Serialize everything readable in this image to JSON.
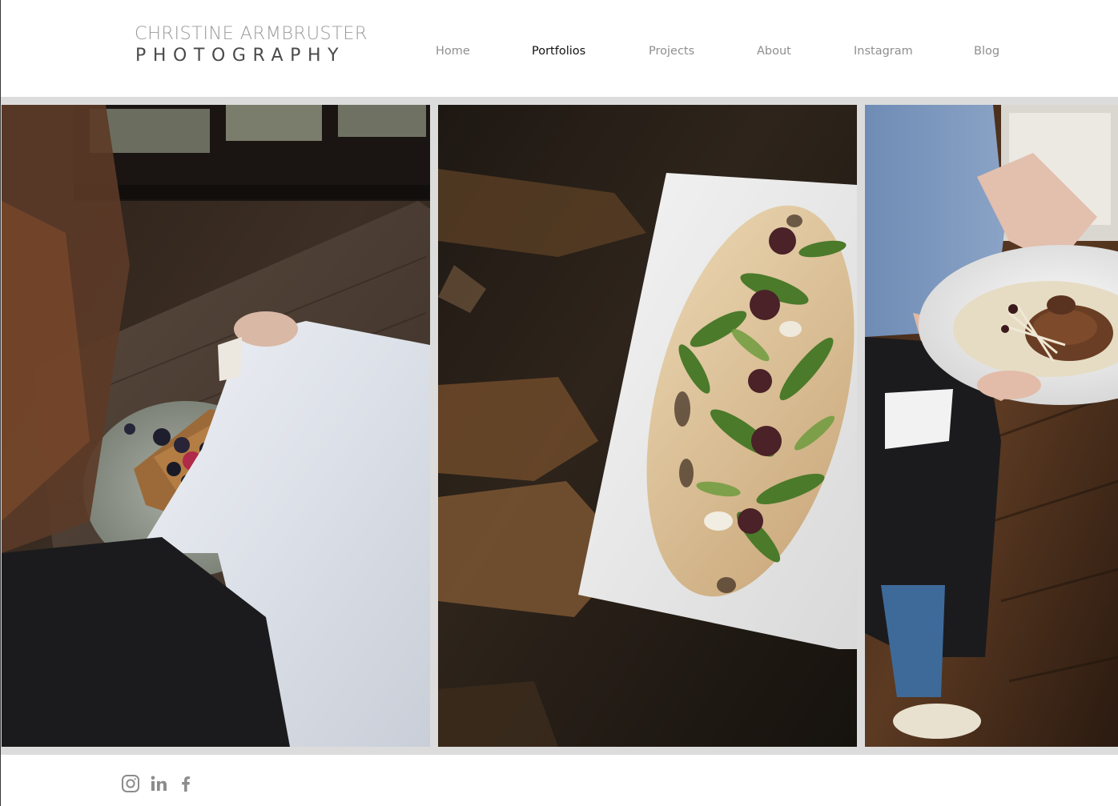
{
  "logo": {
    "line1": "CHRISTINE ARMBRUSTER",
    "line2": "PHOTOGRAPHY"
  },
  "nav": {
    "items": [
      {
        "label": "Home",
        "active": false
      },
      {
        "label": "Portfolios",
        "active": true
      },
      {
        "label": "Projects",
        "active": false
      },
      {
        "label": "About",
        "active": false
      },
      {
        "label": "Instagram",
        "active": false
      },
      {
        "label": "Blog",
        "active": false
      }
    ]
  },
  "gallery": {
    "photos": [
      {
        "subject": "server pouring syrup over french toast with berries"
      },
      {
        "subject": "flatbread with arugula and olive tapenade on white plate"
      },
      {
        "subject": "server holding plate of pork chop"
      }
    ]
  },
  "footer": {
    "social_icons": [
      "instagram-icon",
      "linkedin-icon",
      "facebook-icon"
    ]
  },
  "colors": {
    "nav_text": "#8f8f8f",
    "nav_active": "#111111",
    "logo_light": "#9a9a9a",
    "logo_dark": "#4a4a4a",
    "divider": "#dcdcdc",
    "icon": "#8c8c8c"
  }
}
